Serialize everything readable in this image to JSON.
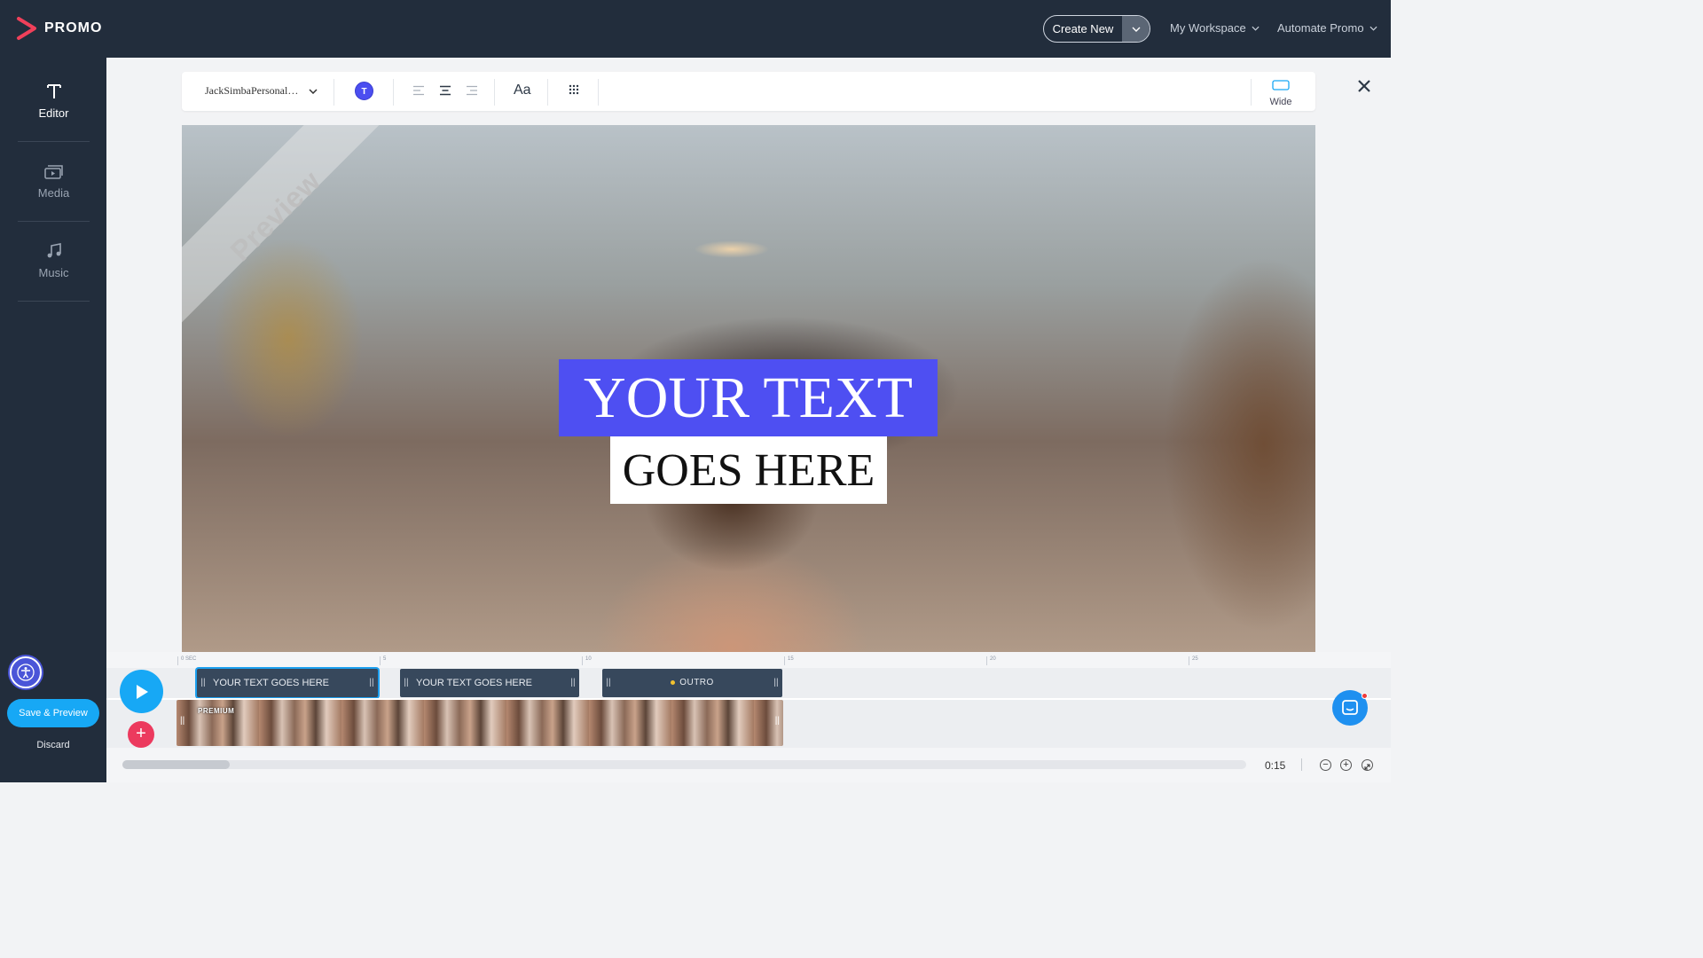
{
  "app": {
    "logo_text": "PROMO",
    "brand_color": "#f0405a"
  },
  "topbar": {
    "create_new": "Create New",
    "my_workspace": "My Workspace",
    "automate_promo": "Automate Promo"
  },
  "sidebar": {
    "items": [
      {
        "label": "Editor",
        "icon": "text-t-icon",
        "active": true
      },
      {
        "label": "Media",
        "icon": "media-stack-icon",
        "active": false
      },
      {
        "label": "Music",
        "icon": "music-note-icon",
        "active": false
      }
    ],
    "save_preview": "Save & Preview",
    "discard": "Discard"
  },
  "toolbar": {
    "font_name": "JackSimbaPersonal…",
    "color_swatch_letter": "T",
    "color_swatch_value": "#4b4ef0",
    "text_size_label": "Aa",
    "ratio_label": "Wide",
    "selected_alignment": "center"
  },
  "canvas": {
    "watermark": "Preview",
    "text_line1": "YOUR TEXT",
    "text_line2": "GOES HERE",
    "line1_bg": "#4e4ff2",
    "line2_bg": "#ffffff"
  },
  "timeline": {
    "ticks": [
      "0 SEC",
      "5",
      "10",
      "15",
      "20",
      "25"
    ],
    "clips": [
      {
        "label": "YOUR TEXT GOES HERE",
        "selected": true
      },
      {
        "label": "YOUR TEXT GOES HERE",
        "selected": false
      },
      {
        "label": "OUTRO",
        "selected": false
      }
    ],
    "video_badge": "PREMIUM",
    "duration": "0:15",
    "zoom_out": "−",
    "zoom_in": "+"
  }
}
